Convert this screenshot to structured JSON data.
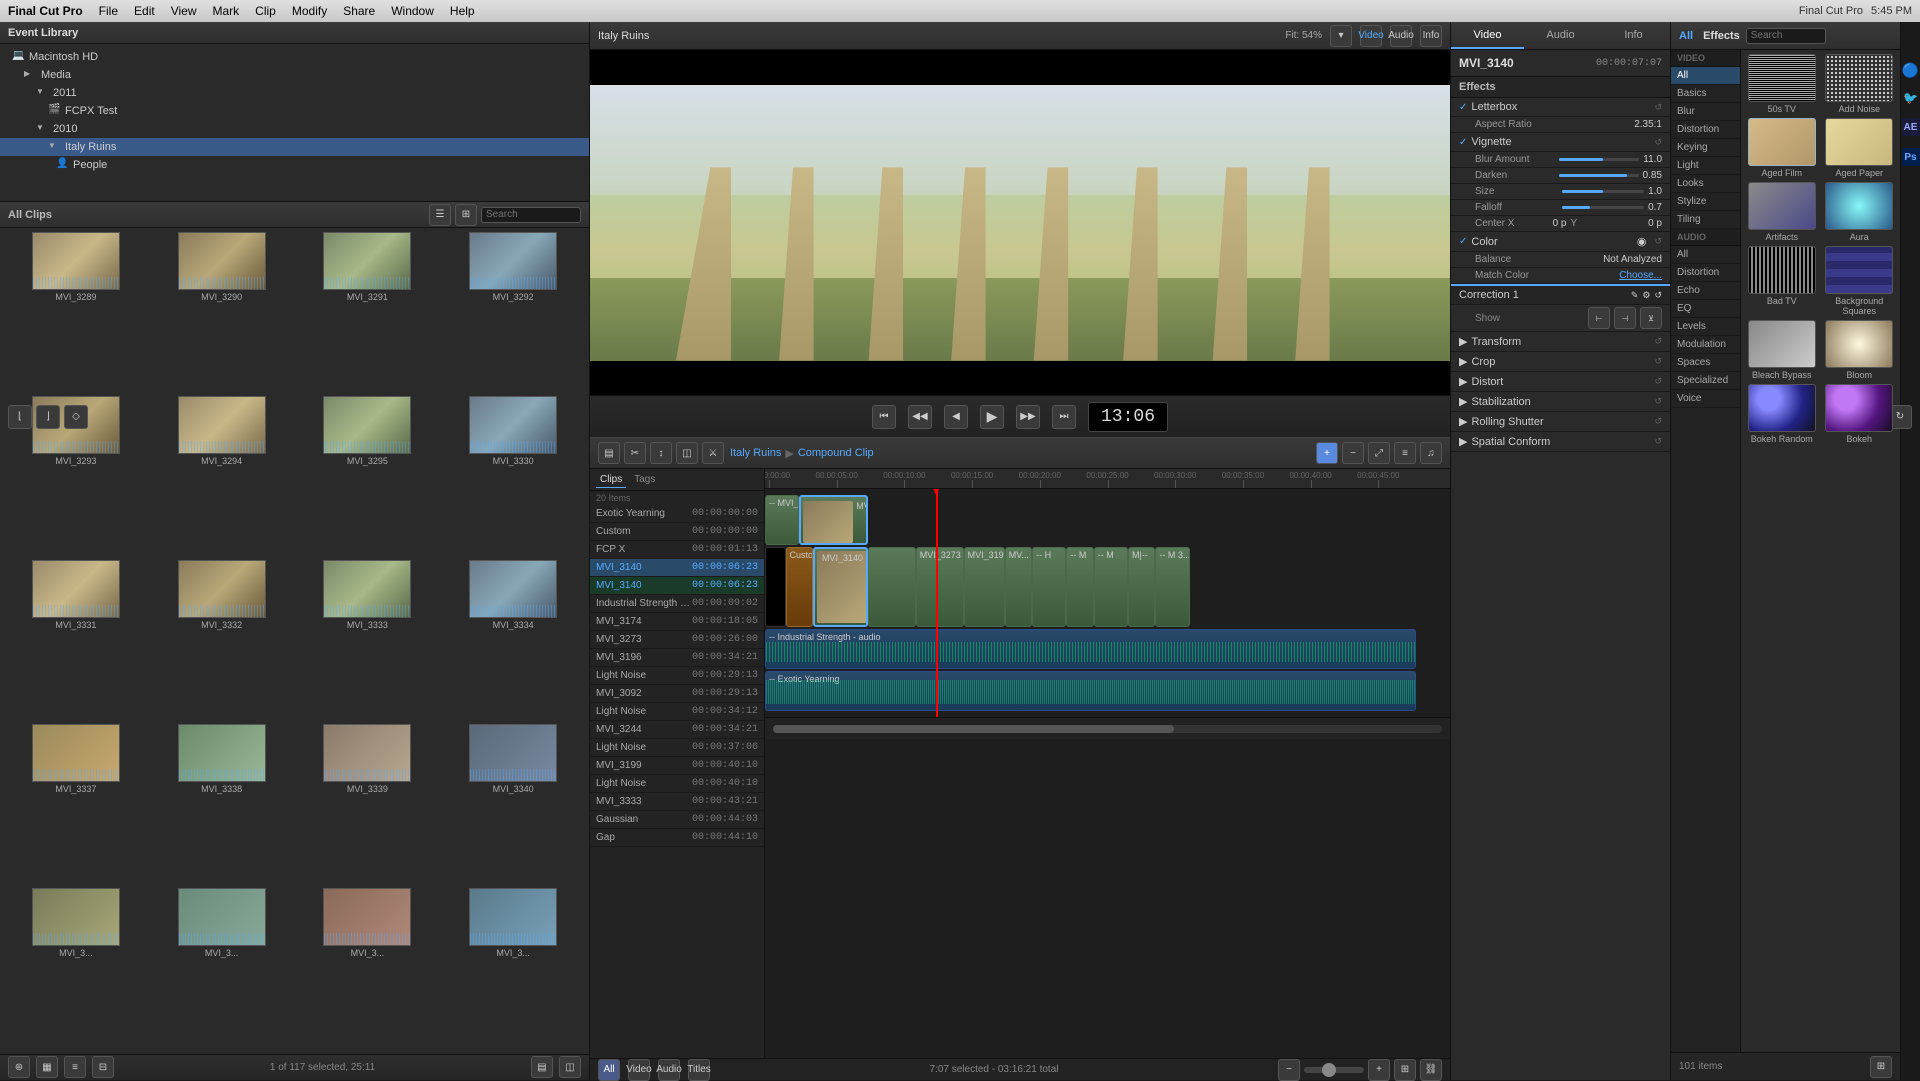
{
  "app": {
    "title": "Final Cut Pro",
    "time": "5:45 PM"
  },
  "menu": {
    "items": [
      "Final Cut Pro",
      "File",
      "Edit",
      "View",
      "Mark",
      "Clip",
      "Modify",
      "Share",
      "Window",
      "Help"
    ]
  },
  "event_library": {
    "title": "Event Library",
    "items": [
      {
        "label": "Macintosh HD",
        "level": 1,
        "type": "hd"
      },
      {
        "label": "Media",
        "level": 2,
        "type": "folder"
      },
      {
        "label": "2011",
        "level": 3,
        "type": "folder"
      },
      {
        "label": "FCPX Test",
        "level": 4,
        "type": "folder"
      },
      {
        "label": "2010",
        "level": 3,
        "type": "folder"
      },
      {
        "label": "Italy Ruins",
        "level": 4,
        "type": "folder",
        "selected": true
      },
      {
        "label": "People",
        "level": 5,
        "type": "folder"
      }
    ]
  },
  "browser": {
    "label": "All Clips",
    "status": "1 of 117 selected, 25:11",
    "clips": [
      {
        "name": "MVI_3289"
      },
      {
        "name": "MVI_3290"
      },
      {
        "name": "MVI_3291"
      },
      {
        "name": "MVI_3292"
      },
      {
        "name": "MVI_3293"
      },
      {
        "name": "MVI_3294"
      },
      {
        "name": "MVI_3295"
      },
      {
        "name": "MVI_3330"
      },
      {
        "name": "MVI_3331"
      },
      {
        "name": "MVI_3332"
      },
      {
        "name": "MVI_3333"
      },
      {
        "name": "MVI_3334"
      },
      {
        "name": "MVI_3337"
      },
      {
        "name": "MVI_3338"
      },
      {
        "name": "MVI_3339"
      },
      {
        "name": "MVI_3340"
      },
      {
        "name": "MVI_3..."
      },
      {
        "name": "MVI_3..."
      },
      {
        "name": "MVI_3..."
      },
      {
        "name": "MVI_3..."
      }
    ]
  },
  "preview": {
    "title": "Italy Ruins",
    "fit_label": "Fit: 54%"
  },
  "timecode": {
    "display": "13:06",
    "selected": "7:07 selected - 03:16:21 total"
  },
  "inspector": {
    "tabs": [
      "Video",
      "Audio",
      "Info"
    ],
    "active_tab": "Video",
    "clip_name": "MVI_3140",
    "timecode": "00:00:07:07",
    "effects_label": "Effects",
    "sections": [
      {
        "name": "Letterbox",
        "expanded": true,
        "properties": [
          {
            "name": "Aspect Ratio",
            "value": "2.35:1"
          }
        ]
      },
      {
        "name": "Vignette",
        "expanded": true,
        "properties": [
          {
            "name": "Blur Amount",
            "value": "11.0"
          },
          {
            "name": "Darken",
            "value": "0.85"
          },
          {
            "name": "Size",
            "value": "1.0"
          },
          {
            "name": "Falloff",
            "value": "0.7"
          },
          {
            "name": "Center X",
            "value": "0 p"
          },
          {
            "name": "Center Y",
            "value": "0 p"
          }
        ]
      },
      {
        "name": "Color",
        "expanded": true,
        "properties": [
          {
            "name": "Balance",
            "value": "Not Analyzed"
          },
          {
            "name": "Match Color",
            "value": "Choose..."
          }
        ]
      },
      {
        "name": "Correction 1",
        "expanded": false
      },
      {
        "name": "Transform",
        "expanded": false
      },
      {
        "name": "Crop",
        "expanded": false
      },
      {
        "name": "Distort",
        "expanded": false
      },
      {
        "name": "Stabilization",
        "expanded": false
      },
      {
        "name": "Rolling Shutter",
        "expanded": false
      },
      {
        "name": "Spatial Conform",
        "expanded": false
      }
    ]
  },
  "timeline": {
    "path_1": "Italy Ruins",
    "path_sep": "▶",
    "path_2": "Compound Clip",
    "clips": [
      {
        "name": "Exotic Yearning",
        "tc": "00:00:00:00"
      },
      {
        "name": "Custom",
        "tc": "00:00:00:00"
      },
      {
        "name": "FCP X",
        "tc": "00:00:01:13"
      },
      {
        "name": "MVI_3140",
        "tc": "00:00:06:23",
        "selected": true
      },
      {
        "name": "MVI_3140",
        "tc": "00:00:06:23",
        "selected": true
      },
      {
        "name": "Industrial Strength - audio",
        "tc": "00:00:09:02"
      },
      {
        "name": "MVI_3174",
        "tc": "00:00:18:05"
      },
      {
        "name": "MVI_3273",
        "tc": "00:00:26:00"
      },
      {
        "name": "MVI_3196",
        "tc": "00:00:34:21"
      },
      {
        "name": "Light Noise",
        "tc": "00:00:29:13"
      },
      {
        "name": "MVI_3092",
        "tc": "00:00:29:13"
      },
      {
        "name": "Light Noise",
        "tc": "00:00:34:12"
      },
      {
        "name": "MVI_3244",
        "tc": "00:00:34:21"
      },
      {
        "name": "Light Noise",
        "tc": "00:00:37:06"
      },
      {
        "name": "MVI_3199",
        "tc": "00:00:40:10"
      },
      {
        "name": "Light Noise",
        "tc": "00:00:40:10"
      },
      {
        "name": "MVI_3333",
        "tc": "00:00:43:21"
      },
      {
        "name": "Gaussian",
        "tc": "00:00:44:03"
      },
      {
        "name": "Gap",
        "tc": "00:00:44:10"
      }
    ]
  },
  "effects_browser": {
    "title": "Effects",
    "all_label": "All",
    "count": "101 items",
    "categories": {
      "video_label": "VIDEO",
      "audio_label": "AUDIO",
      "items_video": [
        "All",
        "Basics",
        "Blur",
        "Distortion",
        "Keying",
        "Light",
        "Looks",
        "Stylize",
        "Tiling",
        "All"
      ],
      "items_audio": [
        "All",
        "Distortion",
        "Echo",
        "EQ",
        "Levels",
        "Modulation",
        "Spaces",
        "Specialized",
        "Voice"
      ]
    },
    "effects": [
      {
        "name": "50s TV",
        "style": "fx-50tv"
      },
      {
        "name": "Add Noise",
        "style": "fx-addnoise"
      },
      {
        "name": "Aged Film",
        "style": "fx-agedfilm"
      },
      {
        "name": "Aged Paper",
        "style": "fx-agedpaper"
      },
      {
        "name": "Artifacts",
        "style": "fx-artifacts"
      },
      {
        "name": "Aura",
        "style": "fx-aura"
      },
      {
        "name": "Bad TV",
        "style": "fx-badsignal"
      },
      {
        "name": "Background Squares",
        "style": "fx-bgsquares"
      },
      {
        "name": "Bleach Bypass",
        "style": "fx-bleachbypass"
      },
      {
        "name": "Bloom",
        "style": "fx-bloom"
      },
      {
        "name": "Bokeh Random",
        "style": "fx-bokeh"
      },
      {
        "name": "Bokeh",
        "style": "fx-bokeh"
      }
    ]
  }
}
